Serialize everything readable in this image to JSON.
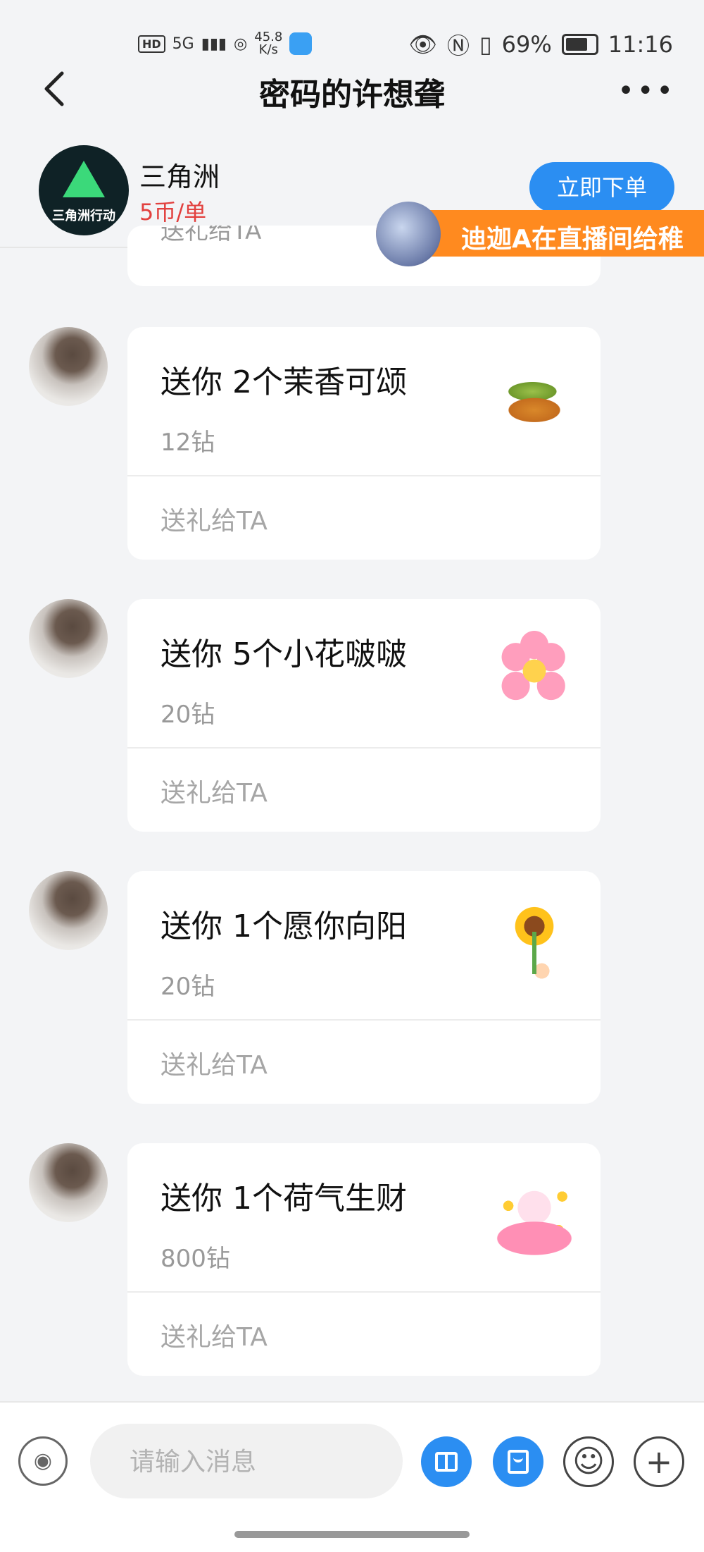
{
  "status_bar": {
    "left_badge": "HD",
    "signal": "5G",
    "speed_value": "45.8",
    "speed_unit": "K/s",
    "battery_percent": "69%",
    "time": "11:16"
  },
  "nav": {
    "title": "密码的许想聋",
    "more_label": "•••"
  },
  "service": {
    "name": "三角洲",
    "price": "5币/单",
    "logo_text": "三角洲行动",
    "order_button": "立即下单"
  },
  "banner": {
    "text": "迪迦A在直播间给稚"
  },
  "partial_card": {
    "action": "送礼给TA"
  },
  "messages": [
    {
      "title": "送你 2个茉香可颂",
      "price": "12钻",
      "action": "送礼给TA",
      "gift_icon": "croissant-gift-icon"
    },
    {
      "title": "送你 5个小花啵啵",
      "price": "20钻",
      "action": "送礼给TA",
      "gift_icon": "pink-flower-gift-icon"
    },
    {
      "title": "送你 1个愿你向阳",
      "price": "20钻",
      "action": "送礼给TA",
      "gift_icon": "sunflower-gift-icon"
    },
    {
      "title": "送你 1个荷气生财",
      "price": "800钻",
      "action": "送礼给TA",
      "gift_icon": "lotus-gift-icon"
    }
  ],
  "input_bar": {
    "placeholder": "请输入消息",
    "voice_icon": "voice-icon",
    "gift_icon": "gift-icon",
    "red_packet_icon": "red-packet-icon",
    "emoji_icon": "emoji-icon",
    "plus_icon": "plus-icon"
  },
  "colors": {
    "accent": "#2b8ef2",
    "price_red": "#e2403e",
    "banner_orange": "#ff8a1f",
    "background": "#f3f4f6"
  }
}
